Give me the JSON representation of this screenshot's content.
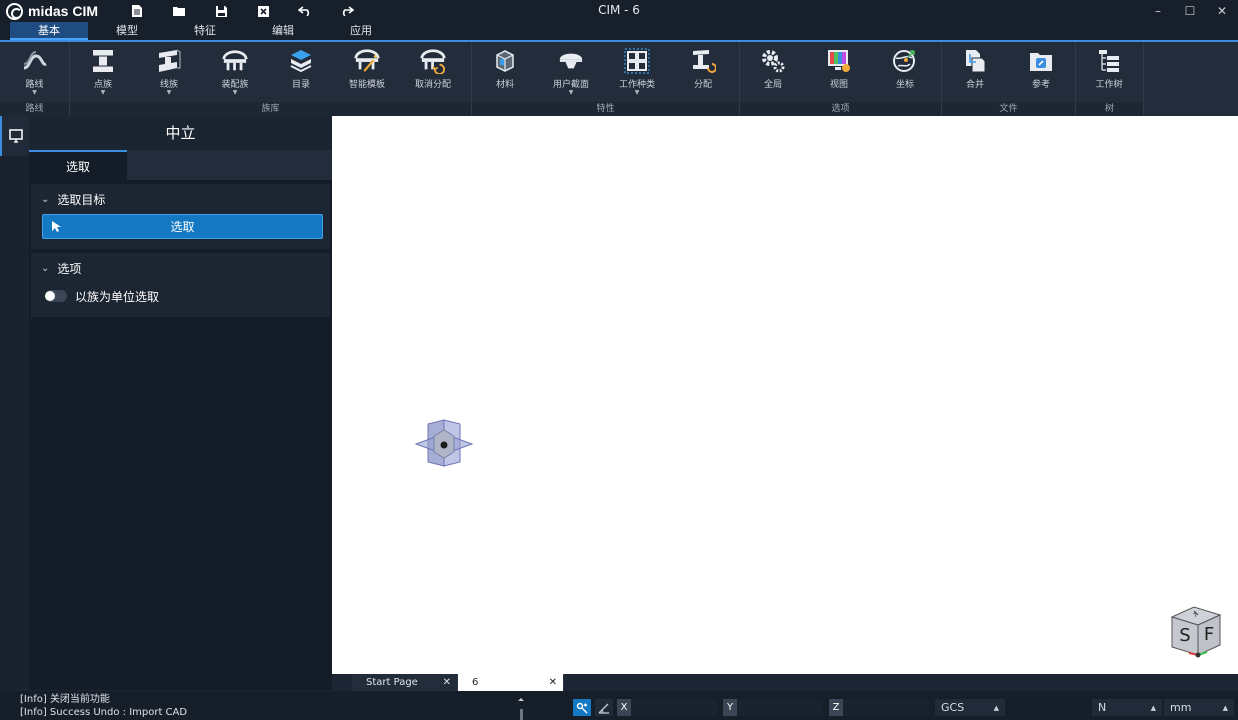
{
  "app": {
    "logo_text": "midas CIM",
    "window_title": "CIM - 6"
  },
  "quick_access": [
    "new-file-icon",
    "open-folder-icon",
    "save-icon",
    "close-file-icon",
    "undo-icon",
    "redo-icon"
  ],
  "window_controls": {
    "minimize": "–",
    "maximize": "☐",
    "close": "✕"
  },
  "menu_tabs": [
    {
      "label": "基本",
      "active": true
    },
    {
      "label": "模型"
    },
    {
      "label": "特征"
    },
    {
      "label": "编辑"
    },
    {
      "label": "应用"
    }
  ],
  "ribbon": {
    "groups": [
      {
        "label": "路线",
        "buttons": [
          {
            "label": "路线",
            "dropdown": true
          }
        ]
      },
      {
        "label": "族库",
        "buttons": [
          {
            "label": "点族",
            "dropdown": true
          },
          {
            "label": "线族",
            "dropdown": true
          },
          {
            "label": "装配族",
            "dropdown": true
          },
          {
            "label": "目录"
          },
          {
            "label": "智能模板"
          },
          {
            "label": "取消分配"
          }
        ]
      },
      {
        "label": "特性",
        "buttons": [
          {
            "label": "材料"
          },
          {
            "label": "用户截面",
            "dropdown": true
          },
          {
            "label": "工作种类",
            "dropdown": true
          },
          {
            "label": "分配"
          }
        ]
      },
      {
        "label": "选项",
        "buttons": [
          {
            "label": "全局"
          },
          {
            "label": "视图"
          },
          {
            "label": "坐标"
          }
        ]
      },
      {
        "label": "文件",
        "buttons": [
          {
            "label": "合并"
          },
          {
            "label": "参考"
          }
        ]
      },
      {
        "label": "树",
        "buttons": [
          {
            "label": "工作树"
          }
        ]
      }
    ]
  },
  "panel": {
    "title": "中立",
    "tab": "选取",
    "section_target": {
      "title": "选取目标",
      "button_label": "选取"
    },
    "section_options": {
      "title": "选项",
      "toggle_label": "以族为单位选取",
      "toggle_on": false
    }
  },
  "doc_tabs": [
    {
      "label": "Start Page",
      "active": false
    },
    {
      "label": "6",
      "active": true
    }
  ],
  "status": {
    "log": [
      "[Info] 关闭当前功能",
      "[Info] Success Undo : Import CAD"
    ],
    "coords": {
      "x_label": "X",
      "y_label": "Y",
      "z_label": "Z"
    },
    "coord_system": "GCS",
    "force_unit": "N",
    "length_unit": "mm"
  },
  "view_cube": {
    "left_face": "S",
    "right_face": "F",
    "top_face": "T"
  },
  "colors": {
    "accent": "#3a8ee0",
    "select_button": "#1479c2",
    "viewport": "#ffffff"
  }
}
